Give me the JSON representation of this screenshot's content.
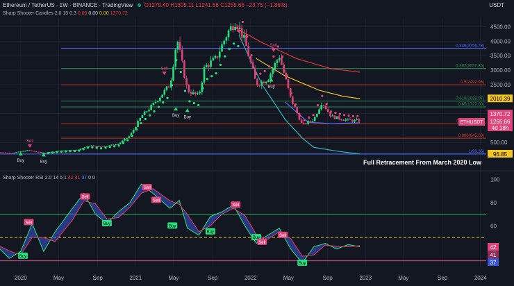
{
  "header": {
    "symbol": "Ethereum / TetherUS · 1W · BINANCE · TradingView",
    "ohlc": "O1279.40 H1305.11 L1241.56 C1255.66 −23.75 (−1.86%)",
    "currency": "USDT"
  },
  "indicator_top": {
    "name": "Sharp Shooter Candles 2.0",
    "params": "15 0.3",
    "v1": "0.00",
    "v2": "0.00",
    "v3": "0.00",
    "v4": "1370.72"
  },
  "indicator_rsi": {
    "name": "Sharp Shooter RSI 2.0",
    "params": "14 5 1",
    "v1": "42",
    "v2": "41",
    "v3": "37",
    "v4": "0",
    "v5": "0"
  },
  "annotation": "Full Retracement From March 2020 Low",
  "colors": {
    "bull": "#26e07f",
    "bear": "#e0457a",
    "bg": "#131722"
  },
  "chart_data": [
    {
      "type": "candlestick",
      "title": "Ethereum / TetherUS",
      "x_ticks": [
        "2020",
        "May",
        "Sep",
        "2021",
        "May",
        "Sep",
        "2022",
        "May",
        "Sep",
        "2023",
        "May",
        "Sep",
        "2024"
      ],
      "y_ticks": [
        500,
        1000,
        1500,
        2000,
        2500,
        3000,
        3500,
        4000,
        4500
      ],
      "ylim": [
        0,
        4800
      ],
      "fib_levels": [
        {
          "label": "0.236(3756.78)",
          "value": 3756.78
        },
        {
          "label": "0.382(3057.85)",
          "value": 3057.85
        },
        {
          "label": "0.5(2492.96)",
          "value": 2492.96
        },
        {
          "label": "0.618(1928.07)",
          "value": 1928.07
        },
        {
          "label": "0.65(1727.00)",
          "value": 1727.0
        },
        {
          "label": "0.786(1145.09)",
          "value": 1145.09
        },
        {
          "label": "0.886(645.09)",
          "value": 645.09
        },
        {
          "label": "1(99.35)",
          "value": 99.35
        }
      ],
      "price_labels": [
        {
          "text": "2010.39",
          "value": 2010.39
        },
        {
          "text": "1370.72",
          "value": 1370.72
        },
        {
          "text": "ETHUSDT",
          "value": 1255.66
        },
        {
          "text": "1255.66",
          "value": 1255.66
        },
        {
          "text": "4d 18h",
          "value": 1150
        },
        {
          "text": "96.85",
          "value": 96.85
        }
      ],
      "signals": [
        {
          "text": "Buy",
          "t": 2020.0,
          "price": 150,
          "kind": "buy"
        },
        {
          "text": "Sell",
          "t": 2020.08,
          "price": 340,
          "kind": "sell"
        },
        {
          "text": "Buy",
          "t": 2020.2,
          "price": 110,
          "kind": "buy"
        },
        {
          "text": "Sell",
          "t": 2021.25,
          "price": 2850,
          "kind": "sell"
        },
        {
          "text": "Buy",
          "t": 2021.35,
          "price": 1700,
          "kind": "buy"
        },
        {
          "text": "Buy",
          "t": 2021.45,
          "price": 1650,
          "kind": "buy"
        },
        {
          "text": "Sell",
          "t": 2021.9,
          "price": 4300,
          "kind": "sell"
        },
        {
          "text": "Sell",
          "t": 2022.2,
          "price": 3650,
          "kind": "sell"
        },
        {
          "text": "Buy",
          "t": 2022.18,
          "price": 2700,
          "kind": "buy"
        }
      ],
      "price_series": [
        {
          "t": 2019.77,
          "p": 175
        },
        {
          "t": 2019.92,
          "p": 130
        },
        {
          "t": 2020.06,
          "p": 230
        },
        {
          "t": 2020.2,
          "p": 130
        },
        {
          "t": 2020.35,
          "p": 215
        },
        {
          "t": 2020.5,
          "p": 240
        },
        {
          "t": 2020.6,
          "p": 400
        },
        {
          "t": 2020.7,
          "p": 350
        },
        {
          "t": 2020.85,
          "p": 450
        },
        {
          "t": 2020.95,
          "p": 730
        },
        {
          "t": 2021.05,
          "p": 1400
        },
        {
          "t": 2021.15,
          "p": 1800
        },
        {
          "t": 2021.3,
          "p": 2500
        },
        {
          "t": 2021.36,
          "p": 4100
        },
        {
          "t": 2021.45,
          "p": 2300
        },
        {
          "t": 2021.55,
          "p": 2100
        },
        {
          "t": 2021.6,
          "p": 3100
        },
        {
          "t": 2021.7,
          "p": 3400
        },
        {
          "t": 2021.8,
          "p": 4300
        },
        {
          "t": 2021.87,
          "p": 4700
        },
        {
          "t": 2021.95,
          "p": 4000
        },
        {
          "t": 2022.05,
          "p": 2500
        },
        {
          "t": 2022.15,
          "p": 2700
        },
        {
          "t": 2022.25,
          "p": 3500
        },
        {
          "t": 2022.35,
          "p": 2000
        },
        {
          "t": 2022.45,
          "p": 1100
        },
        {
          "t": 2022.55,
          "p": 1300
        },
        {
          "t": 2022.62,
          "p": 1900
        },
        {
          "t": 2022.7,
          "p": 1400
        },
        {
          "t": 2022.8,
          "p": 1300
        },
        {
          "t": 2022.9,
          "p": 1250
        },
        {
          "t": 2022.95,
          "p": 1255
        }
      ],
      "overlays": [
        {
          "name": "red",
          "color": "#e03a3a",
          "points": [
            [
              2021.85,
              4500
            ],
            [
              2022.1,
              3950
            ],
            [
              2022.4,
              3400
            ],
            [
              2022.7,
              3050
            ],
            [
              2022.95,
              2930
            ]
          ]
        },
        {
          "name": "yellow",
          "color": "#e6c229",
          "points": [
            [
              2022.05,
              3400
            ],
            [
              2022.3,
              2800
            ],
            [
              2022.6,
              2300
            ],
            [
              2022.8,
              2100
            ],
            [
              2022.95,
              2010
            ]
          ]
        },
        {
          "name": "teal",
          "color": "#2fb6c0",
          "points": [
            [
              2021.9,
              4200
            ],
            [
              2022.1,
              2500
            ],
            [
              2022.3,
              1300
            ],
            [
              2022.45,
              650
            ],
            [
              2022.55,
              330
            ],
            [
              2022.75,
              200
            ],
            [
              2022.95,
              99
            ]
          ]
        },
        {
          "name": "blue",
          "color": "#4e6bff",
          "points": [
            [
              2022.3,
              1900
            ],
            [
              2022.5,
              1200
            ],
            [
              2022.7,
              1150
            ],
            [
              2022.95,
              1180
            ]
          ]
        }
      ]
    },
    {
      "type": "line",
      "title": "Sharp Shooter RSI 2.0",
      "y_ticks": [
        40,
        60,
        80,
        100
      ],
      "ylim": [
        25,
        102
      ],
      "levels": [
        70,
        50,
        30
      ],
      "value_labels": [
        {
          "text": "42",
          "value": 42
        },
        {
          "text": "41",
          "value": 41
        },
        {
          "text": "37",
          "value": 37
        }
      ],
      "signals": [
        {
          "text": "Buy",
          "t": 2020.02,
          "value": 34,
          "kind": "buy"
        },
        {
          "text": "Sell",
          "t": 2020.07,
          "value": 63,
          "kind": "sell"
        },
        {
          "text": "Sell",
          "t": 2020.56,
          "value": 85,
          "kind": "sell"
        },
        {
          "text": "Buy",
          "t": 2020.75,
          "value": 62,
          "kind": "buy"
        },
        {
          "text": "Sell",
          "t": 2021.1,
          "value": 93,
          "kind": "sell"
        },
        {
          "text": "Sell",
          "t": 2021.18,
          "value": 82,
          "kind": "sell"
        },
        {
          "text": "Buy",
          "t": 2021.32,
          "value": 60,
          "kind": "buy"
        },
        {
          "text": "Buy",
          "t": 2021.65,
          "value": 55,
          "kind": "buy"
        },
        {
          "text": "Sell",
          "t": 2021.87,
          "value": 78,
          "kind": "sell"
        },
        {
          "text": "Buy",
          "t": 2022.05,
          "value": 50,
          "kind": "buy"
        },
        {
          "text": "Sell",
          "t": 2022.28,
          "value": 52,
          "kind": "sell"
        },
        {
          "text": "Sell",
          "t": 2022.1,
          "value": 46,
          "kind": "sell"
        },
        {
          "text": "Buy",
          "t": 2022.45,
          "value": 28,
          "kind": "buy"
        }
      ],
      "rsi_series": [
        {
          "t": 2019.77,
          "v": 45
        },
        {
          "t": 2019.9,
          "v": 32
        },
        {
          "t": 2020.0,
          "v": 38
        },
        {
          "t": 2020.1,
          "v": 62
        },
        {
          "t": 2020.2,
          "v": 38
        },
        {
          "t": 2020.3,
          "v": 55
        },
        {
          "t": 2020.45,
          "v": 75
        },
        {
          "t": 2020.55,
          "v": 88
        },
        {
          "t": 2020.65,
          "v": 70
        },
        {
          "t": 2020.75,
          "v": 62
        },
        {
          "t": 2020.85,
          "v": 72
        },
        {
          "t": 2020.95,
          "v": 80
        },
        {
          "t": 2021.05,
          "v": 96
        },
        {
          "t": 2021.15,
          "v": 88
        },
        {
          "t": 2021.3,
          "v": 75
        },
        {
          "t": 2021.38,
          "v": 82
        },
        {
          "t": 2021.45,
          "v": 58
        },
        {
          "t": 2021.55,
          "v": 52
        },
        {
          "t": 2021.65,
          "v": 68
        },
        {
          "t": 2021.75,
          "v": 72
        },
        {
          "t": 2021.85,
          "v": 78
        },
        {
          "t": 2021.95,
          "v": 60
        },
        {
          "t": 2022.05,
          "v": 45
        },
        {
          "t": 2022.15,
          "v": 52
        },
        {
          "t": 2022.25,
          "v": 58
        },
        {
          "t": 2022.35,
          "v": 40
        },
        {
          "t": 2022.45,
          "v": 28
        },
        {
          "t": 2022.55,
          "v": 42
        },
        {
          "t": 2022.65,
          "v": 45
        },
        {
          "t": 2022.75,
          "v": 40
        },
        {
          "t": 2022.85,
          "v": 44
        },
        {
          "t": 2022.95,
          "v": 42
        }
      ]
    }
  ]
}
